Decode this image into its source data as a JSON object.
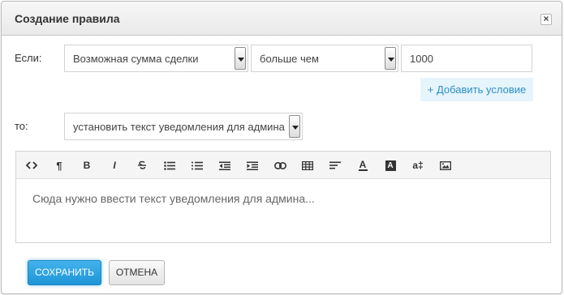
{
  "dialog": {
    "title": "Создание правила",
    "close_icon": "×"
  },
  "condition": {
    "if_label": "Если:",
    "field_value": "Возможная сумма сделки",
    "operator_value": "больше чем",
    "amount_value": "1000",
    "add_condition_label": "+ Добавить условие"
  },
  "action": {
    "then_label": "то:",
    "action_value": "установить текст уведомления для админа"
  },
  "editor": {
    "placeholder": "Сюда нужно ввести текст уведомления для админа...",
    "toolbar_icons": [
      "code-icon",
      "paragraph-icon",
      "bold-icon",
      "italic-icon",
      "strikethrough-icon",
      "unordered-list-icon",
      "ordered-list-icon",
      "outdent-icon",
      "indent-icon",
      "link-icon",
      "table-icon",
      "align-icon",
      "font-color-icon",
      "background-color-icon",
      "font-size-icon",
      "image-icon"
    ],
    "bold_glyph": "B",
    "italic_glyph": "I",
    "paragraph_glyph": "¶",
    "font_color_glyph": "A",
    "bg_color_glyph": "A",
    "font_size_glyph": "a‡"
  },
  "footer": {
    "save_label": "СОХРАНИТЬ",
    "cancel_label": "ОТМЕНА"
  },
  "colors": {
    "accent": "#1e94d7",
    "link": "#2a8fc9",
    "add_bg": "#e6f4fb"
  }
}
